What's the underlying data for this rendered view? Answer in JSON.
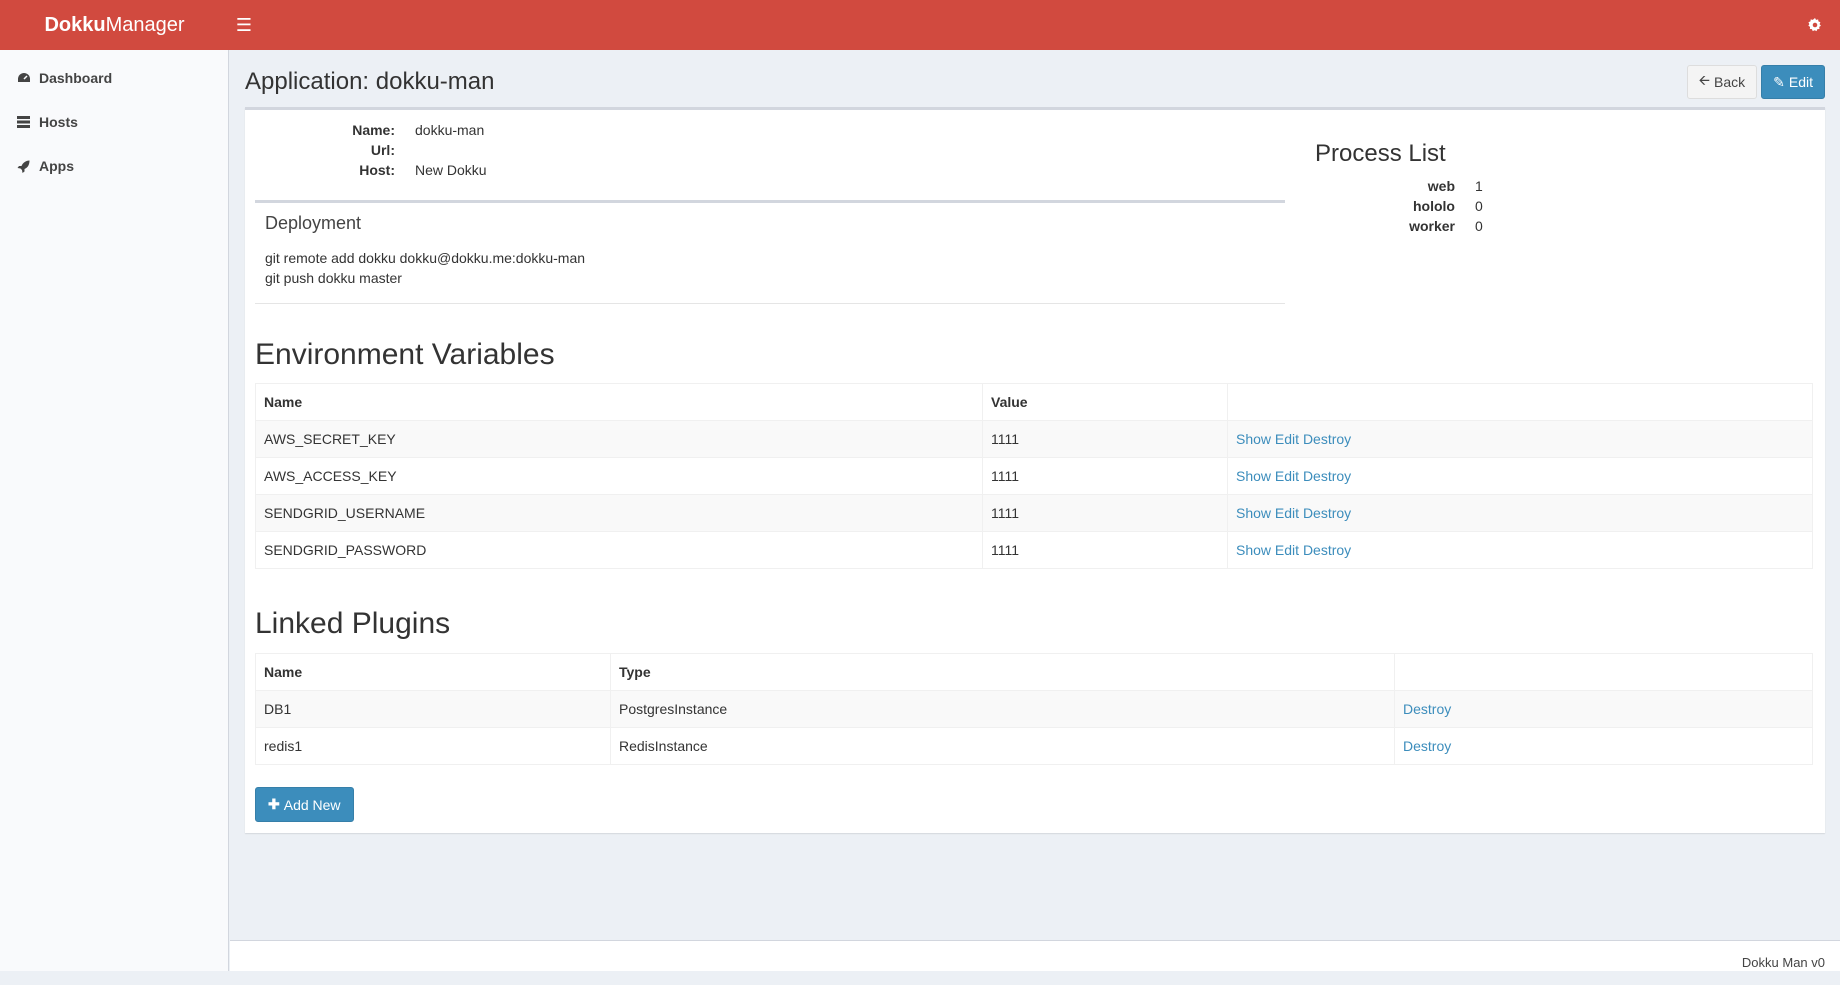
{
  "topbar": {
    "brand_bold": "Dokku",
    "brand_light": "Manager",
    "color": "#d14a3f"
  },
  "sidebar": {
    "items": [
      {
        "label": "Dashboard",
        "icon": "dashboard-icon"
      },
      {
        "label": "Hosts",
        "icon": "server-icon"
      },
      {
        "label": "Apps",
        "icon": "rocket-icon"
      }
    ]
  },
  "page": {
    "title": "Application: dokku-man",
    "back_label": "Back",
    "edit_label": "Edit"
  },
  "app": {
    "name_label": "Name:",
    "name_value": "dokku-man",
    "url_label": "Url:",
    "url_value": "",
    "host_label": "Host:",
    "host_value": "New Dokku"
  },
  "deployment": {
    "title": "Deployment",
    "line1": "git remote add dokku dokku@dokku.me:dokku-man",
    "line2": "git push dokku master"
  },
  "process_list": {
    "title": "Process List",
    "items": [
      {
        "name": "web",
        "count": "1"
      },
      {
        "name": "hololo",
        "count": "0"
      },
      {
        "name": "worker",
        "count": "0"
      }
    ]
  },
  "env_vars": {
    "title": "Environment Variables",
    "headers": {
      "name": "Name",
      "value": "Value"
    },
    "rows": [
      {
        "name": "AWS_SECRET_KEY",
        "value": "1111"
      },
      {
        "name": "AWS_ACCESS_KEY",
        "value": "1111"
      },
      {
        "name": "SENDGRID_USERNAME",
        "value": "1111"
      },
      {
        "name": "SENDGRID_PASSWORD",
        "value": "1111"
      }
    ],
    "actions": {
      "show": "Show",
      "edit": "Edit",
      "destroy": "Destroy"
    }
  },
  "plugins": {
    "title": "Linked Plugins",
    "headers": {
      "name": "Name",
      "type": "Type"
    },
    "rows": [
      {
        "name": "DB1",
        "type": "PostgresInstance"
      },
      {
        "name": "redis1",
        "type": "RedisInstance"
      }
    ],
    "destroy_label": "Destroy",
    "add_label": "Add New"
  },
  "footer": {
    "text": "Dokku Man v0"
  }
}
